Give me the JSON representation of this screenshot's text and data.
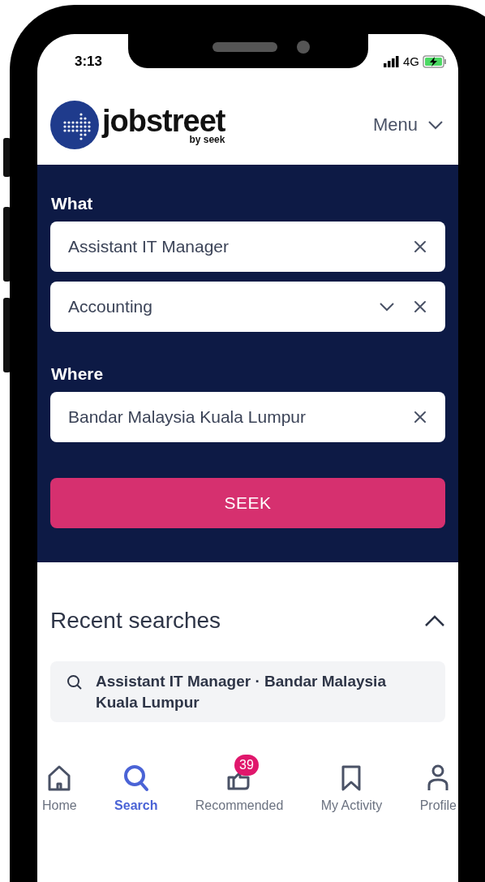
{
  "status_bar": {
    "time": "3:13",
    "network": "4G"
  },
  "header": {
    "logo": {
      "name": "jobstreet",
      "tagline": "by seek"
    },
    "menu": "Menu"
  },
  "search": {
    "what_label": "What",
    "fields": [
      {
        "value": "Assistant IT Manager",
        "kind": "text"
      },
      {
        "value": "Accounting",
        "kind": "dropdown"
      }
    ],
    "where_label": "Where",
    "where": {
      "value": "Bandar Malaysia Kuala Lumpur"
    },
    "button": "SEEK"
  },
  "recent": {
    "title": "Recent searches",
    "expanded": true,
    "items": [
      "Assistant IT Manager · Bandar Malaysia Kuala Lumpur"
    ]
  },
  "nav": [
    {
      "label": "Home",
      "selected": false
    },
    {
      "label": "Search",
      "selected": true
    },
    {
      "label": "Recommended",
      "selected": false,
      "badge": "39"
    },
    {
      "label": "My Activity",
      "selected": false
    },
    {
      "label": "Profile",
      "selected": false
    }
  ]
}
